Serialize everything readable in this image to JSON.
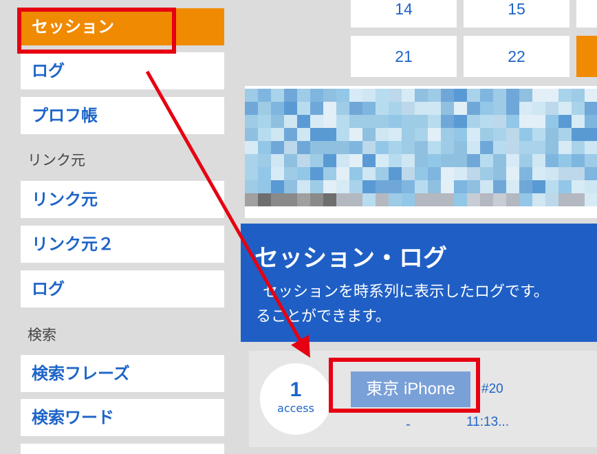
{
  "sidebar": {
    "items_top": [
      {
        "label": "セッション",
        "active": true
      },
      {
        "label": "ログ"
      },
      {
        "label": "プロフ帳"
      }
    ],
    "section_link": "リンク元",
    "items_link": [
      {
        "label": "リンク元"
      },
      {
        "label": "リンク元２"
      },
      {
        "label": "ログ"
      }
    ],
    "section_search": "検索",
    "items_search": [
      {
        "label": "検索フレーズ"
      },
      {
        "label": "検索ワード"
      }
    ]
  },
  "calendar": {
    "row1": [
      "14",
      "15"
    ],
    "row2": [
      "21",
      "22"
    ]
  },
  "panel": {
    "title": "セッション・ログ",
    "description": "セッションを時系列に表示したログです。",
    "description_line2": "ることができます。"
  },
  "session": {
    "access_count": "1",
    "access_label": "access",
    "badge": "東京 iPhone",
    "id": "#20",
    "dash": "-",
    "time": "11:13..."
  },
  "colors": {
    "accent_orange": "#f08a00",
    "panel_blue": "#1f5fc5",
    "annotation_red": "#e60012"
  }
}
